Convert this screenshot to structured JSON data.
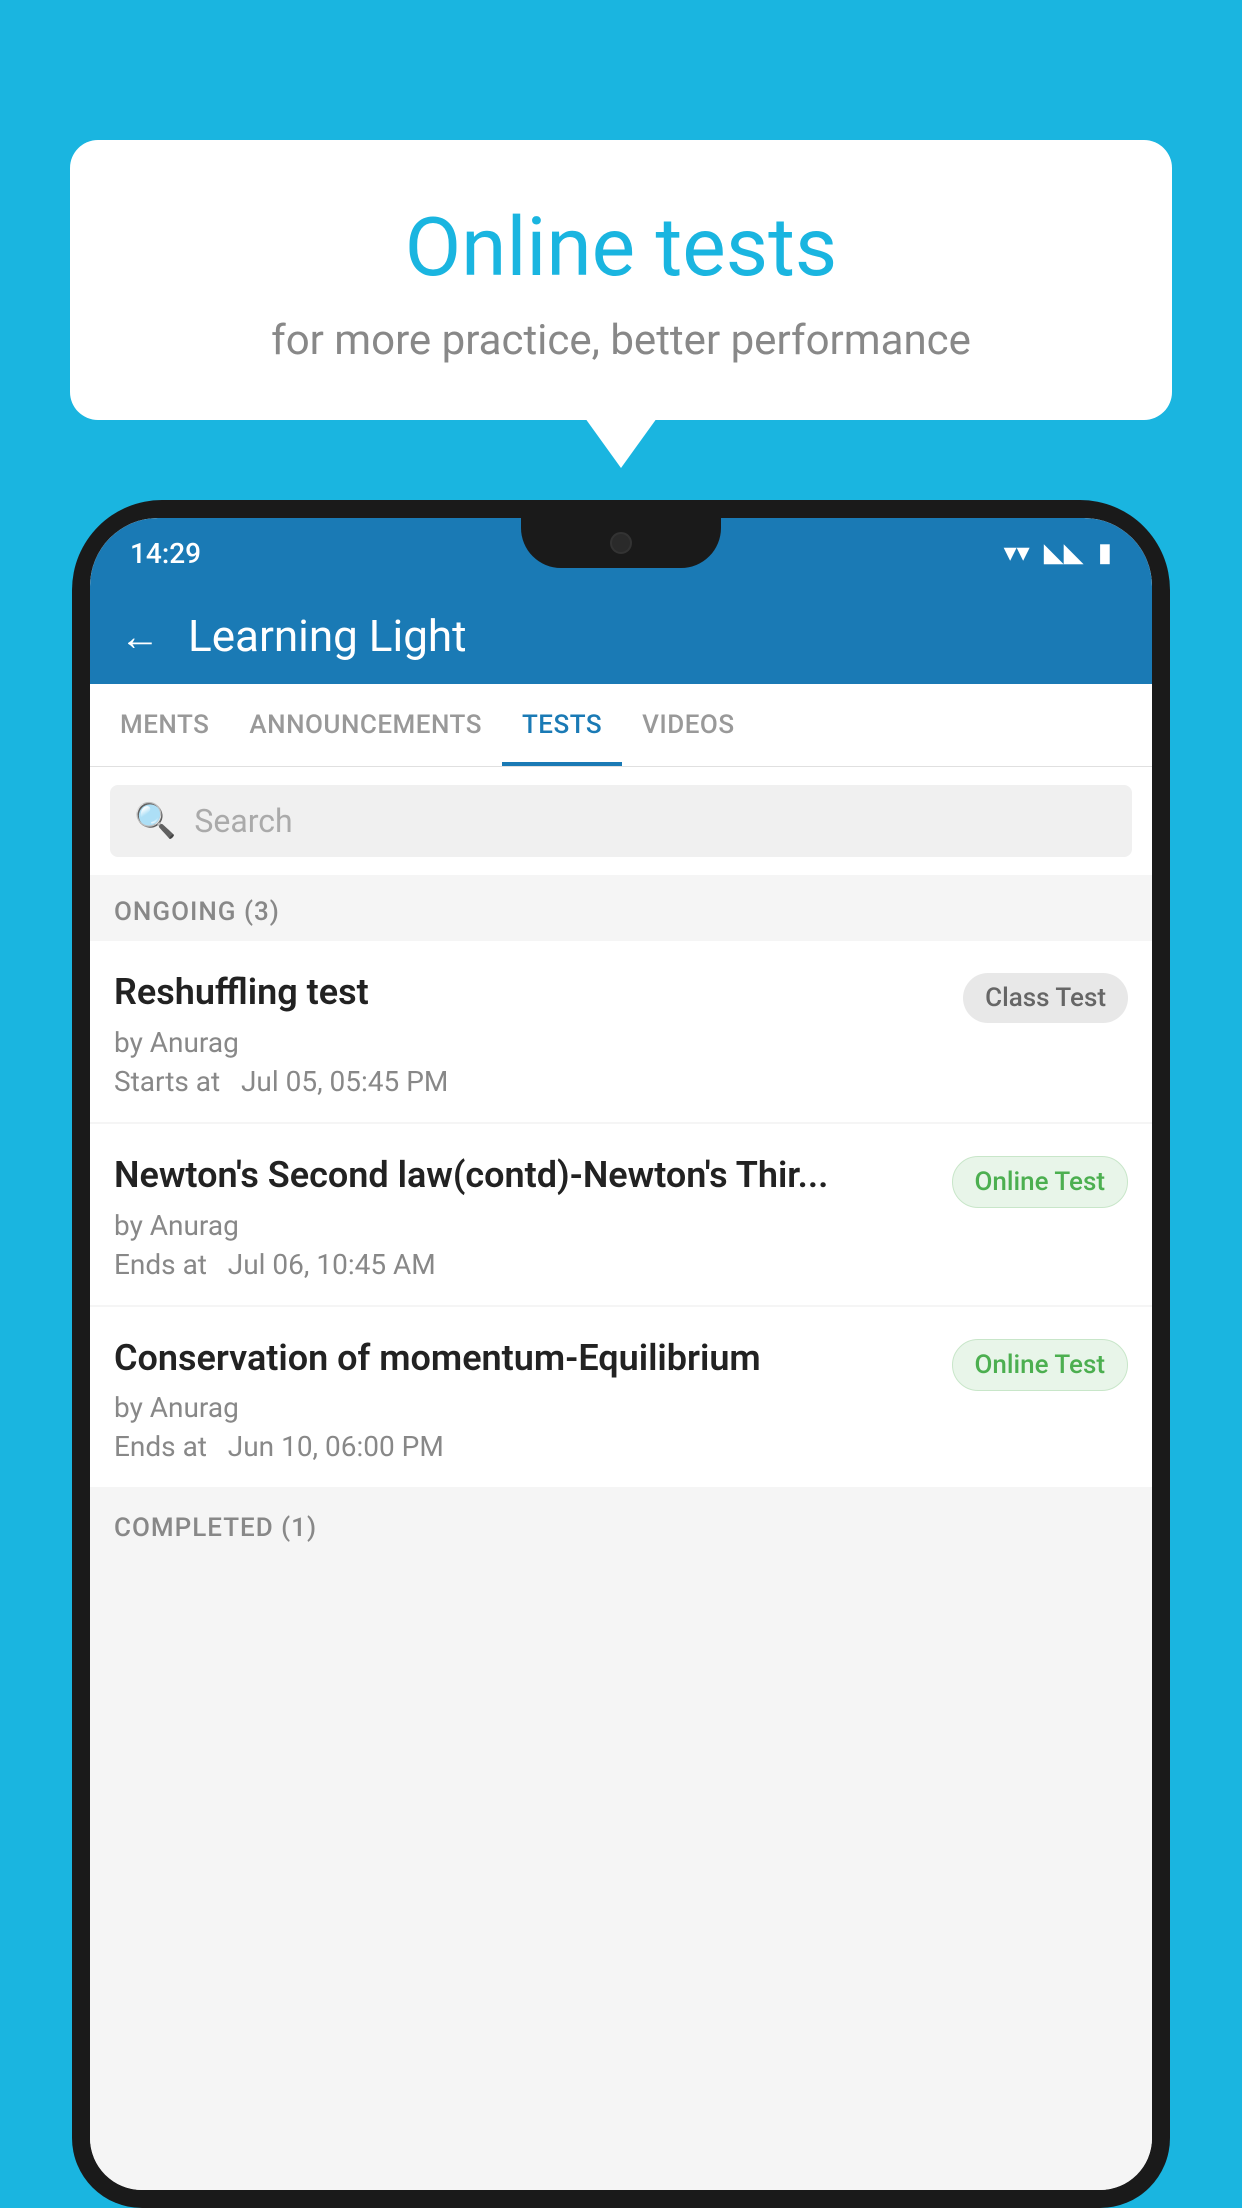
{
  "background": {
    "color": "#1ab5e0"
  },
  "speech_bubble": {
    "title": "Online tests",
    "subtitle": "for more practice, better performance"
  },
  "phone": {
    "status_bar": {
      "time": "14:29",
      "wifi": "▼",
      "signal": "▲",
      "battery": "▮"
    },
    "header": {
      "back_label": "←",
      "title": "Learning Light"
    },
    "tabs": [
      {
        "label": "MENTS",
        "active": false
      },
      {
        "label": "ANNOUNCEMENTS",
        "active": false
      },
      {
        "label": "TESTS",
        "active": true
      },
      {
        "label": "VIDEOS",
        "active": false
      }
    ],
    "search": {
      "placeholder": "Search"
    },
    "sections": [
      {
        "header": "ONGOING (3)",
        "items": [
          {
            "name": "Reshuffling test",
            "by": "by Anurag",
            "date": "Starts at  Jul 05, 05:45 PM",
            "badge": "Class Test",
            "badge_type": "class"
          },
          {
            "name": "Newton's Second law(contd)-Newton's Thir...",
            "by": "by Anurag",
            "date": "Ends at  Jul 06, 10:45 AM",
            "badge": "Online Test",
            "badge_type": "online"
          },
          {
            "name": "Conservation of momentum-Equilibrium",
            "by": "by Anurag",
            "date": "Ends at  Jun 10, 06:00 PM",
            "badge": "Online Test",
            "badge_type": "online"
          }
        ]
      },
      {
        "header": "COMPLETED (1)",
        "items": []
      }
    ]
  }
}
